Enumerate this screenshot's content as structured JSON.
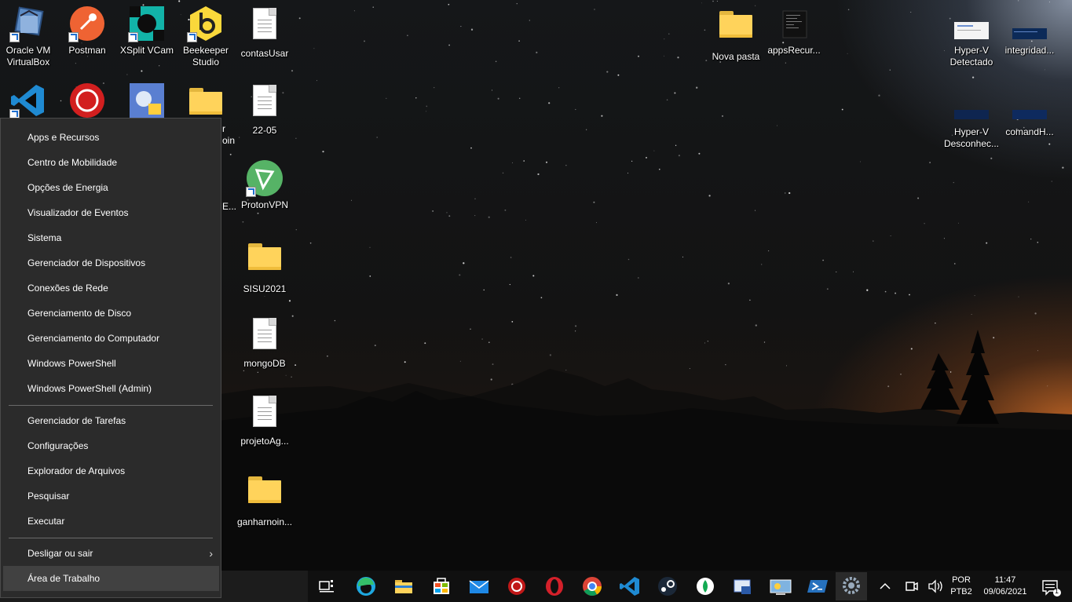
{
  "desktop": {
    "icons": [
      {
        "label": "Oracle VM\nVirtualBox"
      },
      {
        "label": "Postman"
      },
      {
        "label": "XSplit VCam"
      },
      {
        "label": "Beekeeper\nStudio"
      },
      {
        "label": "contasUsar"
      },
      {
        "label": "Nova pasta"
      },
      {
        "label": "appsRecur..."
      },
      {
        "label": "Hyper-V\nDetectado"
      },
      {
        "label": "integridad..."
      },
      {
        "label": "22-05"
      },
      {
        "label": "Hyper-V\nDesconhec..."
      },
      {
        "label": "comandH..."
      },
      {
        "label": "ProtonVPN"
      },
      {
        "label": "SISU2021"
      },
      {
        "label": "mongoDB"
      },
      {
        "label": "projetoAg..."
      },
      {
        "label": "ganharnoin..."
      }
    ],
    "partial_labels": [
      "r",
      "oin",
      "E..."
    ]
  },
  "context_menu": {
    "items": [
      {
        "label": "Apps e Recursos"
      },
      {
        "label": "Centro de Mobilidade"
      },
      {
        "label": "Opções de Energia"
      },
      {
        "label": "Visualizador de Eventos"
      },
      {
        "label": "Sistema"
      },
      {
        "label": "Gerenciador de Dispositivos"
      },
      {
        "label": "Conexões de Rede"
      },
      {
        "label": "Gerenciamento de Disco"
      },
      {
        "label": "Gerenciamento do Computador"
      },
      {
        "label": "Windows PowerShell"
      },
      {
        "label": "Windows PowerShell (Admin)"
      },
      {
        "label": "Gerenciador de Tarefas"
      },
      {
        "label": "Configurações"
      },
      {
        "label": "Explorador de Arquivos"
      },
      {
        "label": "Pesquisar"
      },
      {
        "label": "Executar"
      },
      {
        "label": "Desligar ou sair"
      },
      {
        "label": "Área de Trabalho"
      }
    ],
    "submenu_arrow": "›"
  },
  "taskbar": {
    "apps": [
      "task-view-icon",
      "edge-icon",
      "file-explorer-icon",
      "store-icon",
      "mail-icon",
      "anydesk-icon",
      "opera-icon",
      "chrome-icon",
      "vscode-icon",
      "steam-icon",
      "mongodb-compass-icon",
      "network-tool-icon",
      "remote-desktop-icon",
      "powershell-icon",
      "settings-icon"
    ],
    "tray": {
      "language_top": "POR",
      "language_bottom": "PTB2",
      "time": "11:47",
      "date": "09/06/2021",
      "notification_count": "1"
    }
  },
  "colors": {
    "menu_bg": "#2b2b2b",
    "menu_hover": "#414141",
    "taskbar_bg": "#101010",
    "folder_yellow": "#ffd35b"
  }
}
